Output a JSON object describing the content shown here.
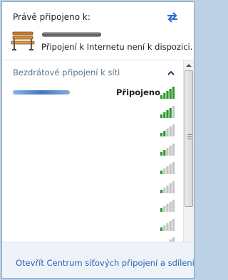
{
  "header": {
    "connected_label": "Právě připojeno k:",
    "status_text": "Připojení k Internetu není k dispozici.",
    "icons": {
      "refresh": "refresh-arrows-icon",
      "network": "park-bench-icon"
    }
  },
  "wireless": {
    "section_title": "Bezdrátové připojení k síti",
    "collapse_icon": "chevron-up-icon",
    "networks": [
      {
        "state": "Připojeno",
        "signal_bars": 5
      },
      {
        "state": "",
        "signal_bars": 4
      },
      {
        "state": "",
        "signal_bars": 2
      },
      {
        "state": "",
        "signal_bars": 2
      },
      {
        "state": "",
        "signal_bars": 1
      },
      {
        "state": "",
        "signal_bars": 1
      },
      {
        "state": "",
        "signal_bars": 1
      },
      {
        "state": "",
        "signal_bars": 1
      },
      {
        "state": "",
        "signal_bars": 1
      }
    ]
  },
  "footer": {
    "link": "Otevřít Centrum síťových připojení a sdílení"
  },
  "colors": {
    "link": "#2a62b3",
    "section_title": "#5c7488",
    "signal_on": "#2c9b2f",
    "signal_off": "#c4c4c4"
  }
}
